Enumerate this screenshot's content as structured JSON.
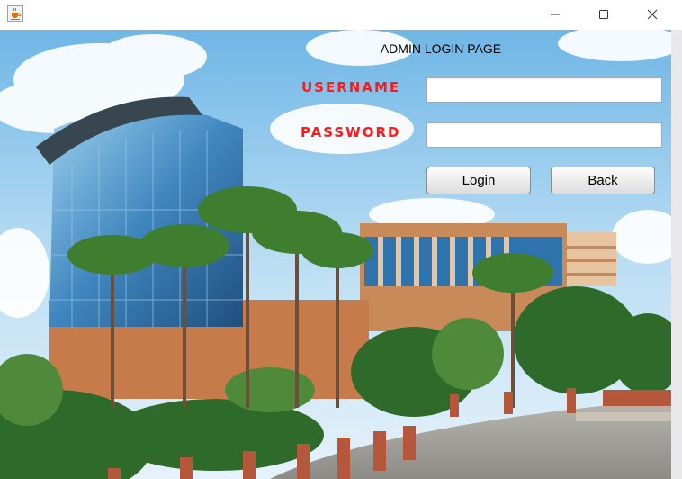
{
  "window": {
    "app_icon": "java-coffee-cup-icon",
    "controls": [
      "minimize-icon",
      "maximize-icon",
      "close-icon"
    ]
  },
  "login_page": {
    "title": "ADMIN LOGIN PAGE",
    "username_label": "USERNAME",
    "password_label": "PASSWORD",
    "username_value": "",
    "password_value": "",
    "login_button": "Login",
    "back_button": "Back",
    "label_color": "#ff1a1a",
    "background_image": "campus-building-photo"
  }
}
